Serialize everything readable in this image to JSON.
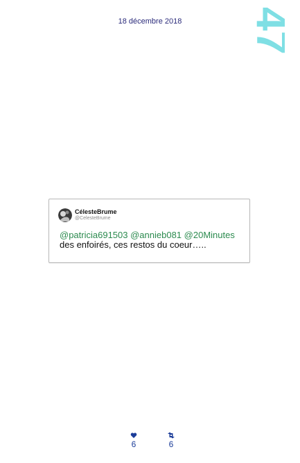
{
  "header": {
    "date": "18 décembre 2018",
    "page_number": "47"
  },
  "tweet": {
    "author_name": "CélesteBrume",
    "author_handle": "@CelesteBrume",
    "mentions": [
      "@patricia691503",
      "@annieb081",
      "@20Minutes"
    ],
    "body_text": "des enfoirés, ces restos du coeur…..",
    "likes": "6",
    "retweets": "6"
  },
  "colors": {
    "page_number": "#7fdfe4",
    "mention": "#2b8a4e",
    "stat": "#1c3d99",
    "date": "#2a2a7a"
  },
  "icons": {
    "like": "heart-icon",
    "retweet": "retweet-icon"
  }
}
